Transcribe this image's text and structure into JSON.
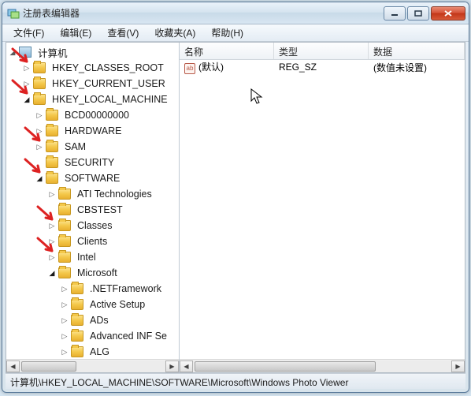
{
  "window": {
    "title": "注册表编辑器"
  },
  "menu": [
    "文件(F)",
    "编辑(E)",
    "查看(V)",
    "收藏夹(A)",
    "帮助(H)"
  ],
  "tree": {
    "root": "计算机",
    "nodes": [
      {
        "label": "HKEY_CLASSES_ROOT",
        "depth": 1,
        "exp": "▷",
        "arrow": true
      },
      {
        "label": "HKEY_CURRENT_USER",
        "depth": 1,
        "exp": "▷",
        "arrow": false
      },
      {
        "label": "HKEY_LOCAL_MACHINE",
        "depth": 1,
        "exp": "◢",
        "arrow": true
      },
      {
        "label": "BCD00000000",
        "depth": 2,
        "exp": "▷",
        "arrow": false
      },
      {
        "label": "HARDWARE",
        "depth": 2,
        "exp": "▷",
        "arrow": false
      },
      {
        "label": "SAM",
        "depth": 2,
        "exp": "▷",
        "arrow": true
      },
      {
        "label": "SECURITY",
        "depth": 2,
        "exp": "",
        "arrow": false
      },
      {
        "label": "SOFTWARE",
        "depth": 2,
        "exp": "◢",
        "arrow": true
      },
      {
        "label": "ATI Technologies",
        "depth": 3,
        "exp": "▷",
        "arrow": false
      },
      {
        "label": "CBSTEST",
        "depth": 3,
        "exp": "",
        "arrow": false
      },
      {
        "label": "Classes",
        "depth": 3,
        "exp": "▷",
        "arrow": true
      },
      {
        "label": "Clients",
        "depth": 3,
        "exp": "▷",
        "arrow": false
      },
      {
        "label": "Intel",
        "depth": 3,
        "exp": "▷",
        "arrow": true
      },
      {
        "label": "Microsoft",
        "depth": 3,
        "exp": "◢",
        "arrow": false
      },
      {
        "label": ".NETFramework",
        "depth": 4,
        "exp": "▷",
        "arrow": false
      },
      {
        "label": "Active Setup",
        "depth": 4,
        "exp": "▷",
        "arrow": false
      },
      {
        "label": "ADs",
        "depth": 4,
        "exp": "▷",
        "arrow": false
      },
      {
        "label": "Advanced INF Se",
        "depth": 4,
        "exp": "▷",
        "arrow": false
      },
      {
        "label": "ALG",
        "depth": 4,
        "exp": "▷",
        "arrow": false
      }
    ]
  },
  "list": {
    "columns": {
      "name": "名称",
      "type": "类型",
      "data": "数据"
    },
    "rows": [
      {
        "name": "(默认)",
        "type": "REG_SZ",
        "data": "(数值未设置)"
      }
    ]
  },
  "statusbar": "计算机\\HKEY_LOCAL_MACHINE\\SOFTWARE\\Microsoft\\Windows Photo Viewer"
}
